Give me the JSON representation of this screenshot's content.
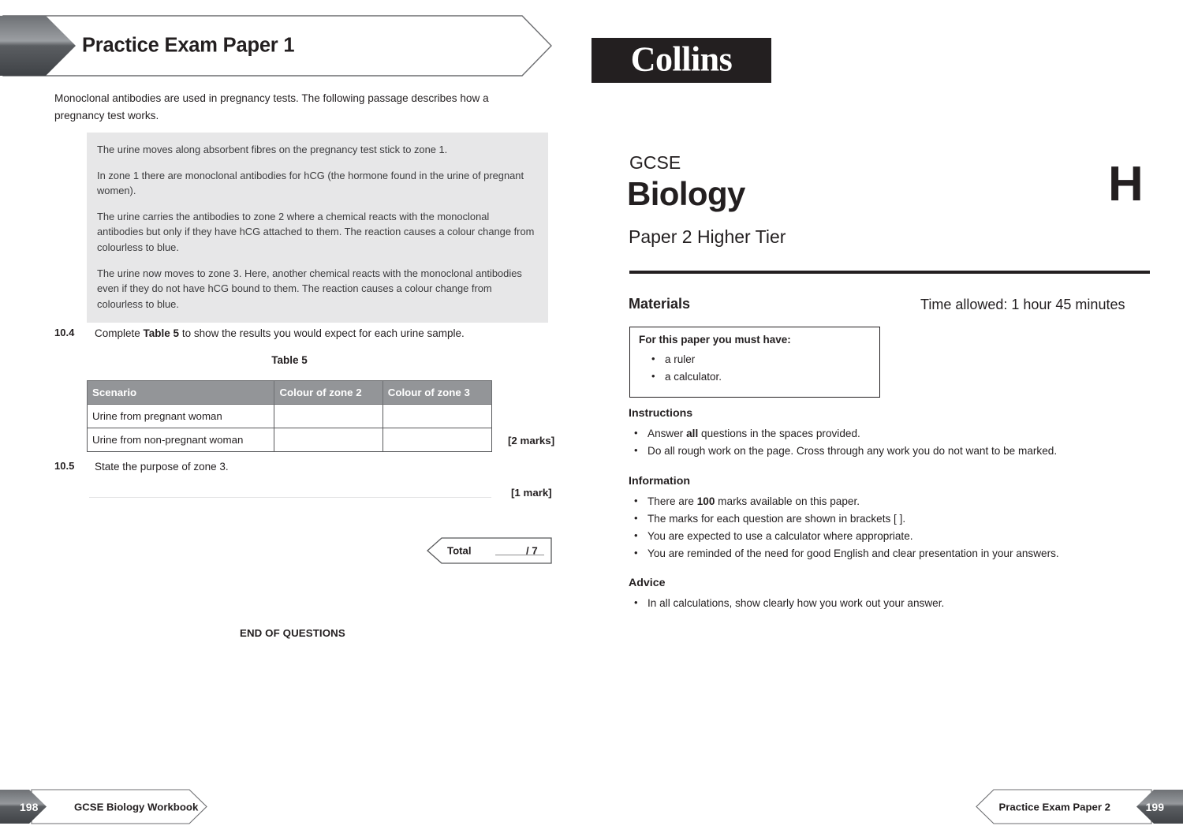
{
  "left_page": {
    "banner_title": "Practice Exam Paper 1",
    "intro": "Monoclonal antibodies are used in pregnancy tests. The following passage describes how a pregnancy test works.",
    "passage": [
      "The urine moves along absorbent fibres on the pregnancy test stick to zone 1.",
      "In zone 1 there are monoclonal antibodies for hCG (the hormone found in the urine of pregnant women).",
      "The urine carries the antibodies to zone 2 where a chemical reacts with the monoclonal antibodies but only if they have hCG attached to them. The reaction causes a colour change from colourless to blue.",
      "The urine now moves to zone 3. Here, another chemical reacts with the monoclonal antibodies even if they do not have hCG bound to them. The reaction causes a colour change from colourless to blue."
    ],
    "q104": {
      "number": "10.4",
      "text_before": "Complete ",
      "text_bold": "Table 5",
      "text_after": " to show the results you would expect for each urine sample.",
      "marks": "[2 marks]"
    },
    "table5": {
      "caption": "Table 5",
      "headers": [
        "Scenario",
        "Colour of zone 2",
        "Colour of zone 3"
      ],
      "rows": [
        [
          "Urine from pregnant woman",
          "",
          ""
        ],
        [
          "Urine from non-pregnant woman",
          "",
          ""
        ]
      ]
    },
    "q105": {
      "number": "10.5",
      "text": "State the purpose of zone 3.",
      "marks": "[1 mark]"
    },
    "total_box": {
      "label": "Total",
      "out_of": "/ 7"
    },
    "end_of_questions": "END OF QUESTIONS",
    "footer": {
      "page_number": "198",
      "text": "GCSE Biology Workbook"
    }
  },
  "right_page": {
    "logo": "Collins",
    "qualification": "GCSE",
    "subject": "Biology",
    "paper": "Paper 2 Higher Tier",
    "tier_letter": "H",
    "materials_heading": "Materials",
    "time_allowed": "Time allowed: 1 hour 45 minutes",
    "must_have": {
      "title": "For this paper you must have:",
      "items": [
        "a ruler",
        "a calculator."
      ]
    },
    "instructions": {
      "heading": "Instructions",
      "items": [
        "Answer all questions in the spaces provided.",
        "Do all rough work on the page. Cross through any work you do not want to be marked."
      ],
      "item0_before": "Answer ",
      "item0_bold": "all",
      "item0_after": " questions in the spaces provided."
    },
    "information": {
      "heading": "Information",
      "items": [
        "There are 100 marks available on this paper.",
        "The marks for each question are shown in brackets [ ].",
        "You are expected to use a calculator where appropriate.",
        "You are reminded of the need for good English and clear presentation in your answers."
      ],
      "item0_before": "There are ",
      "item0_bold": "100",
      "item0_after": " marks available on this paper."
    },
    "advice": {
      "heading": "Advice",
      "items": [
        "In all calculations, show clearly how you work out your answer."
      ]
    },
    "footer": {
      "page_number": "199",
      "text": "Practice Exam Paper 2"
    }
  },
  "colors": {
    "ink": "#231f20",
    "passage_bg": "#e7e7e8",
    "table_header_bg": "#939598",
    "footer_dark": "#4a4c50"
  }
}
